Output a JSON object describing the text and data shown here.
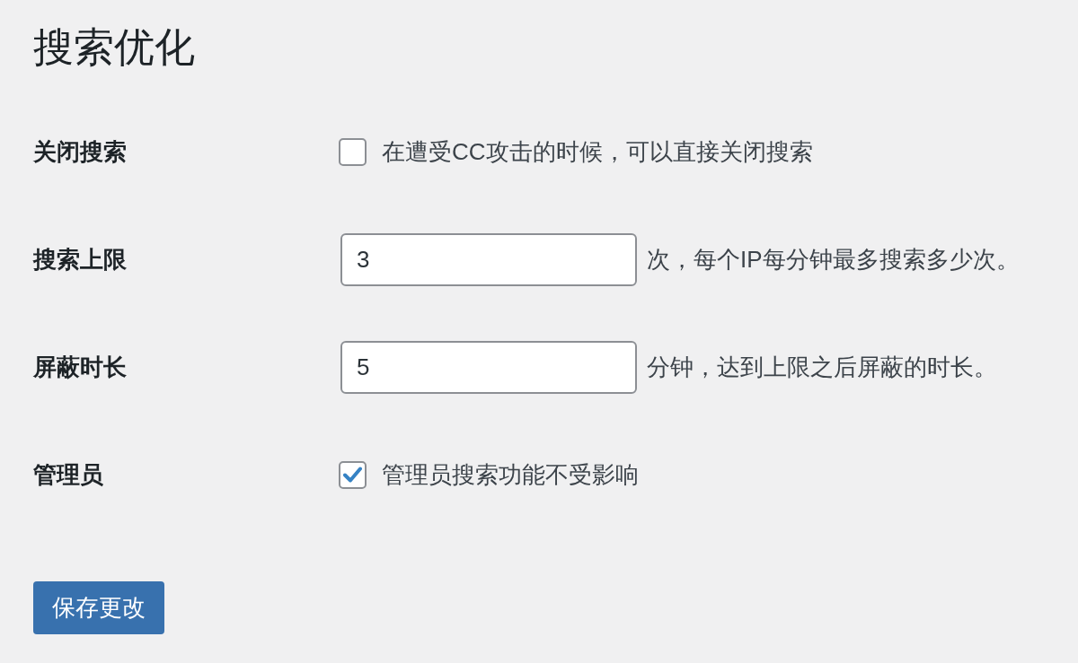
{
  "title": "搜索优化",
  "settings": [
    {
      "label": "关闭搜索",
      "kind": "checkbox",
      "checked": false,
      "description": "在遭受CC攻击的时候，可以直接关闭搜索"
    },
    {
      "label": "搜索上限",
      "kind": "number",
      "value": "3",
      "description": "次，每个IP每分钟最多搜索多少次。"
    },
    {
      "label": "屏蔽时长",
      "kind": "number",
      "value": "5",
      "description": "分钟，达到上限之后屏蔽的时长。"
    },
    {
      "label": "管理员",
      "kind": "checkbox",
      "checked": true,
      "description": "管理员搜索功能不受影响"
    }
  ],
  "save_button": "保存更改"
}
